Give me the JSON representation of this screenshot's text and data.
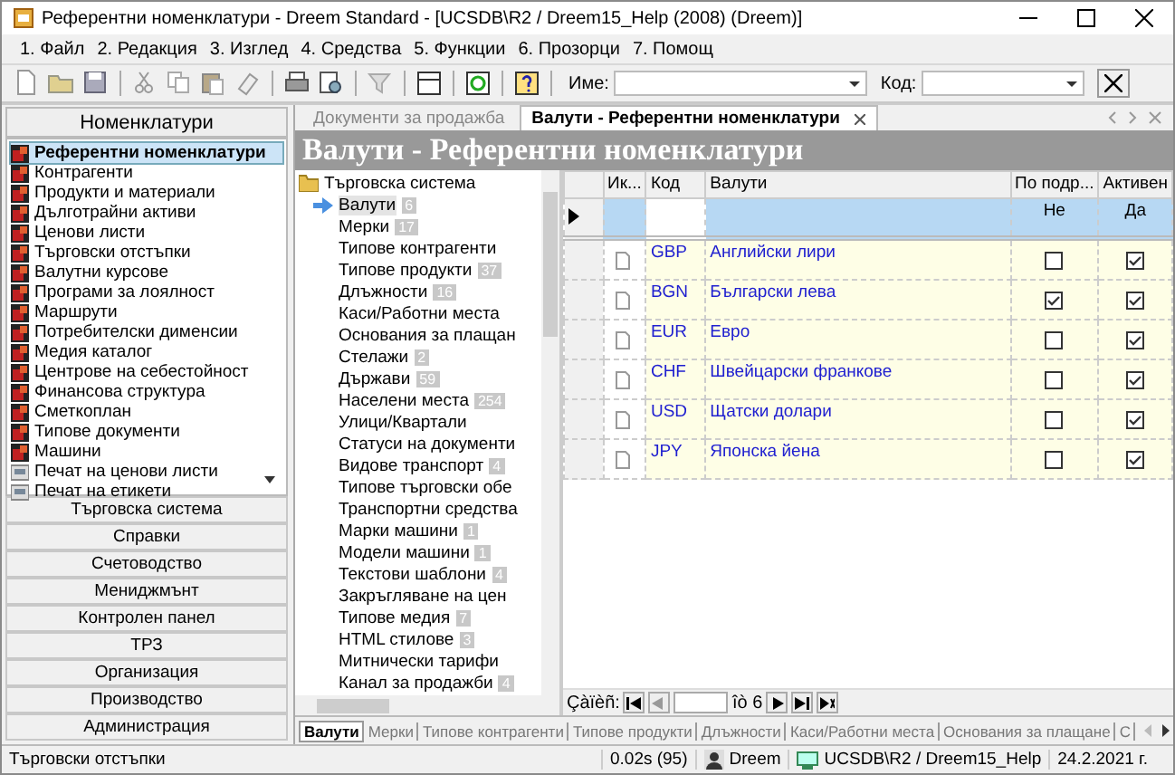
{
  "window": {
    "title": "Референтни номенклатури - Dreem Standard - [UCSDB\\R2 / Dreem15_Help (2008) (Dreem)]"
  },
  "menu": [
    "1. Файл",
    "2. Редакция",
    "3. Изглед",
    "4. Средства",
    "5. Функции",
    "6. Прозорци",
    "7. Помощ"
  ],
  "toolbar": {
    "name_label": "Име:",
    "code_label": "Код:"
  },
  "sidebar": {
    "header": "Номенклатури",
    "items": [
      {
        "label": "Референтни номенклатури",
        "kind": "module",
        "selected": true
      },
      {
        "label": "Контрагенти",
        "kind": "module",
        "selected": false
      },
      {
        "label": "Продукти и материали",
        "kind": "module",
        "selected": false
      },
      {
        "label": "Дълготрайни активи",
        "kind": "module",
        "selected": false
      },
      {
        "label": "Ценови листи",
        "kind": "module",
        "selected": false
      },
      {
        "label": "Търговски отстъпки",
        "kind": "module",
        "selected": false
      },
      {
        "label": "Валутни курсове",
        "kind": "module",
        "selected": false
      },
      {
        "label": "Програми за лоялност",
        "kind": "module",
        "selected": false
      },
      {
        "label": "Маршрути",
        "kind": "module",
        "selected": false
      },
      {
        "label": "Потребителски дименсии",
        "kind": "module",
        "selected": false
      },
      {
        "label": "Медия каталог",
        "kind": "module",
        "selected": false
      },
      {
        "label": "Центрове на себестойност",
        "kind": "module",
        "selected": false
      },
      {
        "label": "Финансова структура",
        "kind": "module",
        "selected": false
      },
      {
        "label": "Сметкоплан",
        "kind": "module",
        "selected": false
      },
      {
        "label": "Типове документи",
        "kind": "module",
        "selected": false
      },
      {
        "label": "Машини",
        "kind": "module",
        "selected": false
      },
      {
        "label": "Печат на ценови листи",
        "kind": "print",
        "selected": false
      },
      {
        "label": "Печат на етикети",
        "kind": "print",
        "selected": false
      }
    ],
    "sections": [
      "Търговска система",
      "Справки",
      "Счетоводство",
      "Мениджмънт",
      "Контролен панел",
      "ТРЗ",
      "Организация",
      "Производство",
      "Администрация"
    ]
  },
  "doc_tabs": [
    {
      "label": "Документи за продажба",
      "selected": false
    },
    {
      "label": "Валути - Референтни номенклатури",
      "selected": true
    }
  ],
  "banner": "Валути - Референтни номенклатури",
  "tree": {
    "root": "Търговска система",
    "children": [
      {
        "label": "Валути",
        "count": "6",
        "selected": true
      },
      {
        "label": "Мерки",
        "count": "17",
        "selected": false
      },
      {
        "label": "Типове контрагенти",
        "selected": false
      },
      {
        "label": "Типове продукти",
        "count": "37",
        "selected": false
      },
      {
        "label": "Длъжности",
        "count": "16",
        "selected": false
      },
      {
        "label": "Каси/Работни места",
        "selected": false
      },
      {
        "label": "Основания за плащан",
        "selected": false
      },
      {
        "label": "Стелажи",
        "count": "2",
        "selected": false
      },
      {
        "label": "Държави",
        "count": "59",
        "selected": false
      },
      {
        "label": "Населени места",
        "count": "254",
        "selected": false
      },
      {
        "label": "Улици/Квартали",
        "selected": false
      },
      {
        "label": "Статуси на документи",
        "selected": false
      },
      {
        "label": "Видове транспорт",
        "count": "4",
        "selected": false
      },
      {
        "label": "Типове търговски обе",
        "selected": false
      },
      {
        "label": "Транспортни средства",
        "selected": false
      },
      {
        "label": "Марки машини",
        "count": "1",
        "selected": false
      },
      {
        "label": "Модели машини",
        "count": "1",
        "selected": false
      },
      {
        "label": "Текстови шаблони",
        "count": "4",
        "selected": false
      },
      {
        "label": "Закръгляване на цен",
        "selected": false
      },
      {
        "label": "Типове медия",
        "count": "7",
        "selected": false
      },
      {
        "label": "HTML стилове",
        "count": "3",
        "selected": false
      },
      {
        "label": "Митнически тарифи",
        "selected": false
      },
      {
        "label": "Канал за продажби",
        "count": "4",
        "selected": false
      }
    ]
  },
  "grid": {
    "columns": [
      "Ик...",
      "Код",
      "Валути",
      "По подр...",
      "Активен"
    ],
    "filter": {
      "default": "Не",
      "active": "Да"
    },
    "rows": [
      {
        "code": "GBP",
        "name": "Английски лири",
        "default": false,
        "active": true
      },
      {
        "code": "BGN",
        "name": "Български лева",
        "default": true,
        "active": true
      },
      {
        "code": "EUR",
        "name": "Евро",
        "default": false,
        "active": true
      },
      {
        "code": "CHF",
        "name": "Швейцарски франкове",
        "default": false,
        "active": true
      },
      {
        "code": "USD",
        "name": "Щатски долари",
        "default": false,
        "active": true
      },
      {
        "code": "JPY",
        "name": "Японска йена",
        "default": false,
        "active": true
      }
    ]
  },
  "navigator": {
    "label": "Çàïèñ:",
    "total": "îò 6"
  },
  "bottom_tabs": [
    {
      "label": "Валути",
      "selected": true
    },
    {
      "label": "Мерки",
      "selected": false
    },
    {
      "label": "Типове контрагенти",
      "selected": false
    },
    {
      "label": "Типове продукти",
      "selected": false
    },
    {
      "label": "Длъжности",
      "selected": false
    },
    {
      "label": "Каси/Работни места",
      "selected": false
    },
    {
      "label": "Основания за плащане",
      "selected": false
    },
    {
      "label": "С",
      "selected": false
    }
  ],
  "status_bar": {
    "text": "Търговски отстъпки",
    "timing": "0.02s (95)",
    "user": "Dreem",
    "database": "UCSDB\\R2 / Dreem15_Help",
    "date": "24.2.2021 г."
  }
}
